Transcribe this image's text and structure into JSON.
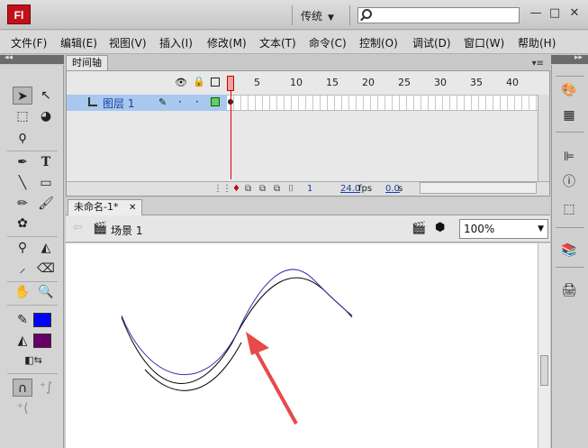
{
  "titlebar": {
    "logo": "Fl",
    "workspace": "传统",
    "search": {
      "value": "",
      "placeholder": ""
    },
    "minimize": "—",
    "restore": "□",
    "close": "✕"
  },
  "menu": [
    "文件(F)",
    "编辑(E)",
    "视图(V)",
    "插入(I)",
    "修改(M)",
    "文本(T)",
    "命令(C)",
    "控制(O)",
    "调试(D)",
    "窗口(W)",
    "帮助(H)"
  ],
  "timeline": {
    "tab": "时间轴",
    "layer_name": "图层 1",
    "ruler": [
      "1",
      "5",
      "10",
      "15",
      "20",
      "25",
      "30",
      "35",
      "40"
    ],
    "current_frame": "1",
    "fps": "24.0",
    "fps_unit": "fps",
    "time": "0.0",
    "time_unit": "s"
  },
  "document": {
    "tab": "未命名-1*",
    "close": "✕",
    "scene": "场景 1",
    "zoom": "100%"
  },
  "colors": {
    "stroke_color": "#0000ff",
    "fill_color": "#660066",
    "curve_selected": "#3333aa",
    "arrow": "#e64a4a"
  },
  "icons": {
    "toolbar": [
      "selection-tool-icon",
      "subselection-tool-icon",
      "free-transform-tool-icon",
      "3d-rotation-tool-icon",
      "lasso-tool-icon",
      "pen-tool-icon",
      "text-tool-icon",
      "line-tool-icon",
      "rectangle-tool-icon",
      "pencil-tool-icon",
      "brush-tool-icon",
      "deco-tool-icon",
      "bone-tool-icon",
      "paint-bucket-tool-icon",
      "eyedropper-tool-icon",
      "eraser-tool-icon",
      "hand-tool-icon",
      "zoom-tool-icon",
      "stroke-color-icon",
      "fill-color-icon",
      "swap-colors-icon",
      "snap-to-objects-icon",
      "smooth-icon",
      "straighten-icon"
    ],
    "right_dock": [
      "color-panel-icon",
      "swatches-panel-icon",
      "align-panel-icon",
      "info-panel-icon",
      "transform-panel-icon",
      "library-panel-icon",
      "properties-panel-icon"
    ]
  }
}
